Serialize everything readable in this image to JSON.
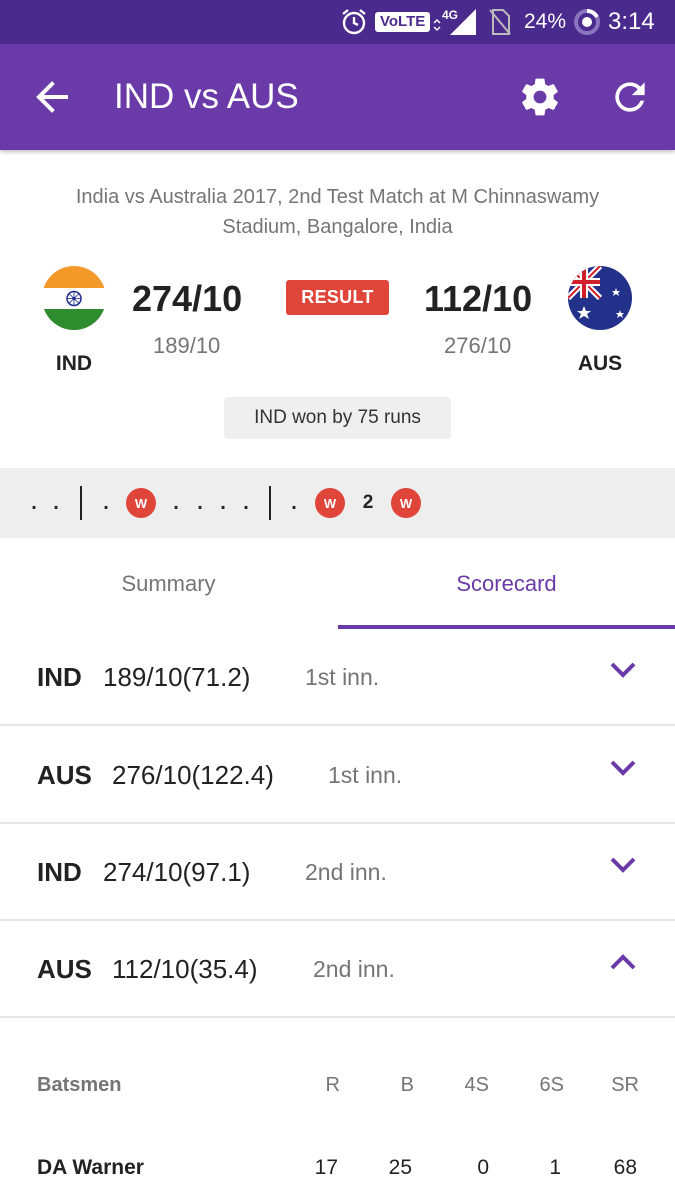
{
  "status_bar": {
    "volte": "VoLTE",
    "network": "4G",
    "battery": "24%",
    "time": "3:14"
  },
  "app_bar": {
    "title": "IND vs AUS",
    "icons": [
      "back-arrow-icon",
      "gear-icon",
      "refresh-icon"
    ]
  },
  "match": {
    "description": "India vs Australia 2017, 2nd Test Match at M Chinnaswamy Stadium, Bangalore, India",
    "status_badge": "RESULT",
    "result_text": "IND won by 75 runs",
    "team1": {
      "code": "IND",
      "score": "274/10",
      "prev_score": "189/10"
    },
    "team2": {
      "code": "AUS",
      "score": "112/10",
      "prev_score": "276/10"
    }
  },
  "ball_strip": [
    {
      "type": "dot",
      "text": "."
    },
    {
      "type": "dot",
      "text": "."
    },
    {
      "type": "sep"
    },
    {
      "type": "dot",
      "text": "."
    },
    {
      "type": "wicket",
      "text": "W"
    },
    {
      "type": "dot",
      "text": "."
    },
    {
      "type": "dot",
      "text": "."
    },
    {
      "type": "dot",
      "text": "."
    },
    {
      "type": "dot",
      "text": "."
    },
    {
      "type": "sep"
    },
    {
      "type": "dot",
      "text": "."
    },
    {
      "type": "wicket",
      "text": "W"
    },
    {
      "type": "num",
      "text": "2"
    },
    {
      "type": "wicket",
      "text": "W"
    }
  ],
  "tabs": [
    {
      "label": "Summary",
      "active": false
    },
    {
      "label": "Scorecard",
      "active": true
    }
  ],
  "innings": [
    {
      "team": "IND",
      "score": "189/10(71.2)",
      "label": "1st inn.",
      "expanded": false
    },
    {
      "team": "AUS",
      "score": "276/10(122.4)",
      "label": "1st inn.",
      "expanded": false
    },
    {
      "team": "IND",
      "score": "274/10(97.1)",
      "label": "2nd inn.",
      "expanded": false
    },
    {
      "team": "AUS",
      "score": "112/10(35.4)",
      "label": "2nd inn.",
      "expanded": true
    }
  ],
  "batsmen": {
    "headers": {
      "name": "Batsmen",
      "r": "R",
      "b": "B",
      "fours": "4S",
      "sixes": "6S",
      "sr": "SR"
    },
    "rows": [
      {
        "name": "DA Warner",
        "r": "17",
        "b": "25",
        "fours": "0",
        "sixes": "1",
        "sr": "68"
      }
    ]
  },
  "colors": {
    "status_bar": "#4a2a8c",
    "app_bar": "#6a3aa8",
    "accent": "#6a3aa8",
    "wicket": "#e0453a",
    "result_badge": "#e0453a"
  }
}
